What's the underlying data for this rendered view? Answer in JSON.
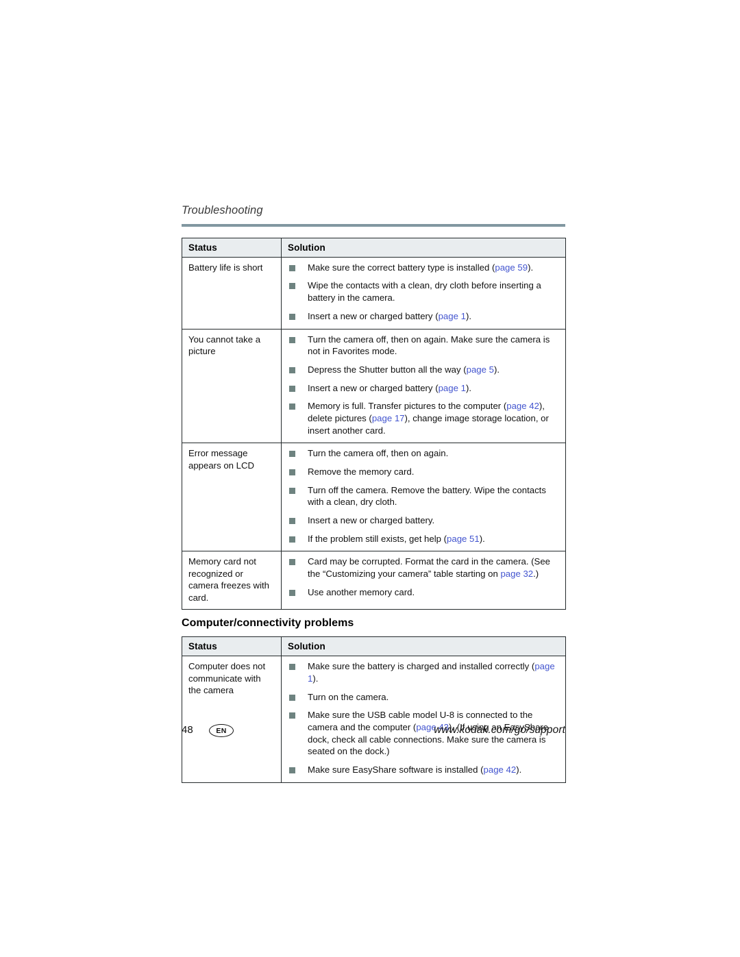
{
  "running_head": "Troubleshooting",
  "tables": [
    {
      "name": "camera-problems-table",
      "headers": {
        "status": "Status",
        "solution": "Solution"
      },
      "rows": [
        {
          "status": "Battery life is short",
          "solutions": [
            [
              {
                "t": "Make sure the correct battery type is installed ("
              },
              {
                "t": "page 59",
                "ref": true
              },
              {
                "t": ")."
              }
            ],
            [
              {
                "t": "Wipe the contacts with a clean, dry cloth before inserting a battery in the camera."
              }
            ],
            [
              {
                "t": "Insert a new or charged battery ("
              },
              {
                "t": "page 1",
                "ref": true
              },
              {
                "t": ")."
              }
            ]
          ]
        },
        {
          "status": "You cannot take a picture",
          "solutions": [
            [
              {
                "t": "Turn the camera off, then on again. Make sure the camera is not in Favorites mode."
              }
            ],
            [
              {
                "t": "Depress the Shutter button all the way ("
              },
              {
                "t": "page 5",
                "ref": true
              },
              {
                "t": ")."
              }
            ],
            [
              {
                "t": "Insert a new or charged battery ("
              },
              {
                "t": "page 1",
                "ref": true
              },
              {
                "t": ")."
              }
            ],
            [
              {
                "t": "Memory is full. Transfer pictures to the computer ("
              },
              {
                "t": "page 42",
                "ref": true
              },
              {
                "t": "), delete pictures ("
              },
              {
                "t": "page 17",
                "ref": true
              },
              {
                "t": "), change image storage location, or insert another card."
              }
            ]
          ]
        },
        {
          "status": "Error message appears on LCD",
          "solutions": [
            [
              {
                "t": "Turn the camera off, then on again."
              }
            ],
            [
              {
                "t": "Remove the memory card."
              }
            ],
            [
              {
                "t": "Turn off the camera. Remove the battery. Wipe the contacts with a clean, dry cloth."
              }
            ],
            [
              {
                "t": "Insert a new or charged battery."
              }
            ],
            [
              {
                "t": "If the problem still exists, get help ("
              },
              {
                "t": "page 51",
                "ref": true
              },
              {
                "t": ")."
              }
            ]
          ]
        },
        {
          "status": "Memory card not recognized or camera freezes with card.",
          "solutions": [
            [
              {
                "t": "Card may be corrupted. Format the card in the camera. (See the “Customizing your camera” table starting on "
              },
              {
                "t": "page 32",
                "ref": true
              },
              {
                "t": ".)"
              }
            ],
            [
              {
                "t": "Use another memory card."
              }
            ]
          ]
        }
      ]
    },
    {
      "name": "computer-connectivity-table",
      "headers": {
        "status": "Status",
        "solution": "Solution"
      },
      "rows": [
        {
          "status": "Computer does not communicate with the camera",
          "solutions": [
            [
              {
                "t": "Make sure the battery is charged and installed correctly ("
              },
              {
                "t": "page 1",
                "ref": true
              },
              {
                "t": ")."
              }
            ],
            [
              {
                "t": "Turn on the camera."
              }
            ],
            [
              {
                "t": "Make sure the USB cable model U-8 is connected to the camera and the computer ("
              },
              {
                "t": "page 43",
                "ref": true
              },
              {
                "t": "). (If using an EasyShare dock, check all cable connections. Make sure the camera is seated on the dock.)"
              }
            ],
            [
              {
                "t": "Make sure EasyShare software is installed ("
              },
              {
                "t": "page 42",
                "ref": true
              },
              {
                "t": ")."
              }
            ]
          ]
        }
      ]
    }
  ],
  "section_heading": "Computer/connectivity problems",
  "footer": {
    "page_number": "48",
    "language_badge": "EN",
    "url": "www.kodak.com/go/support"
  },
  "colors": {
    "rule": "#8197a0",
    "header_bg": "#e9edef",
    "bullet": "#6e8380",
    "page_ref": "#4355cf",
    "border": "#23292b"
  }
}
